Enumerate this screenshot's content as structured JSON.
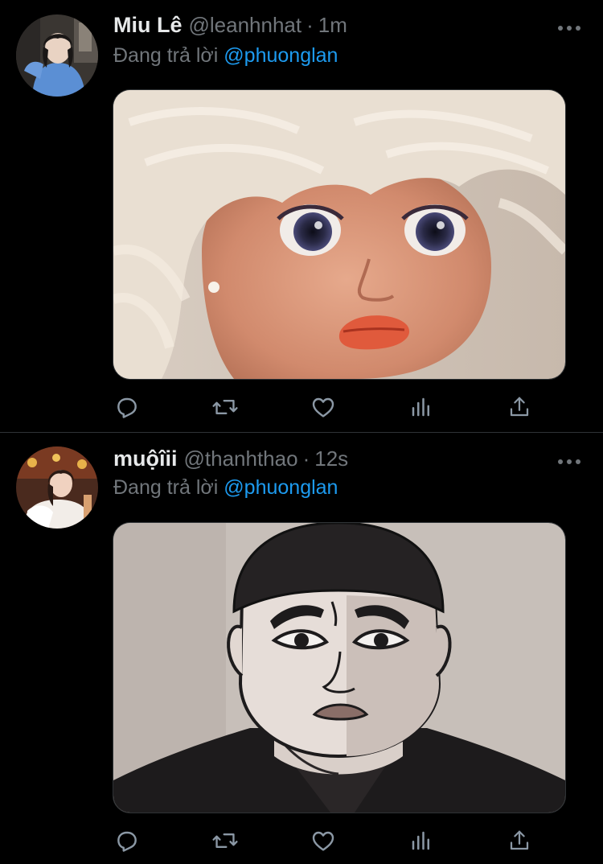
{
  "colors": {
    "background": "#000000",
    "primary_text": "#e7e9ea",
    "secondary_text": "#71767b",
    "accent": "#1d9bf0",
    "divider": "#2f3336"
  },
  "tweets": [
    {
      "name": "Miu Lê",
      "handle": "@leanhnhat",
      "separator": "·",
      "time": "1m",
      "reply_prefix": "Đang trả lời",
      "reply_to": "@phuonglan",
      "avatar_icon": "user-avatar",
      "media": "doll-face-meme-image"
    },
    {
      "name": "muộîii",
      "handle": "@thanhthao",
      "separator": "·",
      "time": "12s",
      "reply_prefix": "Đang trả lời",
      "reply_to": "@phuonglan",
      "avatar_icon": "user-avatar",
      "media": "cartoon-man-cap-meme-image"
    }
  ],
  "action_icons": [
    "reply-icon",
    "retweet-icon",
    "like-icon",
    "analytics-icon",
    "share-icon"
  ]
}
